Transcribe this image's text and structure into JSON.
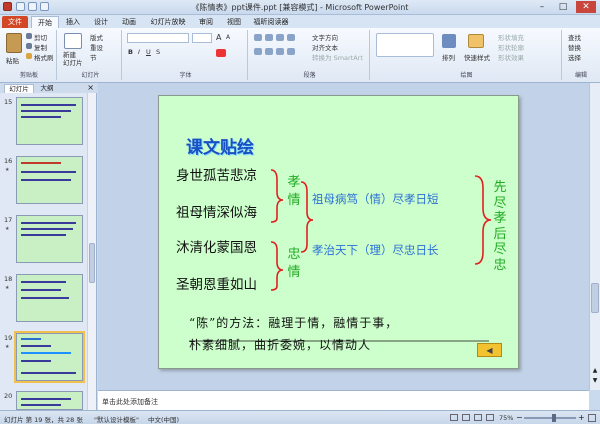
{
  "window": {
    "title": "《陈情表》ppt课件.ppt [兼容模式] - Microsoft PowerPoint",
    "minimize": "–",
    "maximize": "□",
    "close": "✕"
  },
  "tabs": [
    "文件",
    "开始",
    "插入",
    "设计",
    "动画",
    "幻灯片放映",
    "审阅",
    "视图",
    "福昕阅读器"
  ],
  "ribbon": {
    "clipboard": {
      "paste": "粘贴",
      "cut": "剪切",
      "copy": "复制",
      "format": "格式刷",
      "label": "剪贴板"
    },
    "slides": {
      "new_slide": "新建\n幻灯片",
      "layout": "版式",
      "reset": "重设",
      "section": "节",
      "label": "幻灯片"
    },
    "font": {
      "label": "字体",
      "size_up": "A",
      "size_down": "A"
    },
    "paragraph": {
      "label": "段落",
      "text_direction": "文字方向",
      "align_text": "对齐文本",
      "smartart": "转换为 SmartArt"
    },
    "drawing": {
      "arrange": "排列",
      "quick_styles": "快速样式",
      "fill": "形状填充",
      "outline": "形状轮廓",
      "effects": "形状效果",
      "label": "绘图"
    },
    "editing": {
      "find": "查找",
      "replace": "替换",
      "select": "选择",
      "label": "编辑"
    }
  },
  "panel": {
    "tab_slides": "幻灯片",
    "tab_outline": "大纲",
    "close": "×"
  },
  "thumbnails": [
    {
      "num": "15",
      "lines": 3
    },
    {
      "num": "16",
      "lines": 3
    },
    {
      "num": "17",
      "lines": 3
    },
    {
      "num": "18",
      "lines": 3
    },
    {
      "num": "19",
      "lines": 4
    },
    {
      "num": "20",
      "lines": 2
    }
  ],
  "slide": {
    "title": "课文贴绘",
    "left_items": [
      "身世孤苦悲凉",
      "祖母情深似海",
      "沐清化蒙国恩",
      "圣朝恩重如山"
    ],
    "mid_labels": [
      "孝情",
      "忠情"
    ],
    "right_items": [
      "祖母病笃（情）尽孝日短",
      "孝治天下（理）尽忠日长"
    ],
    "far_right": "先尽孝后尽忠",
    "bottom_line1": "“陈”的方法：融理于情，融情于事，",
    "bottom_line2": "朴素细腻，曲折委婉，以情动人",
    "back_button": "◀"
  },
  "notes_placeholder": "单击此处添加备注",
  "status": {
    "slide_info": "幻灯片 第 19 张，共 28 张",
    "theme": "\"默认设计模板\"",
    "language": "中文(中国)",
    "zoom": "75%"
  }
}
